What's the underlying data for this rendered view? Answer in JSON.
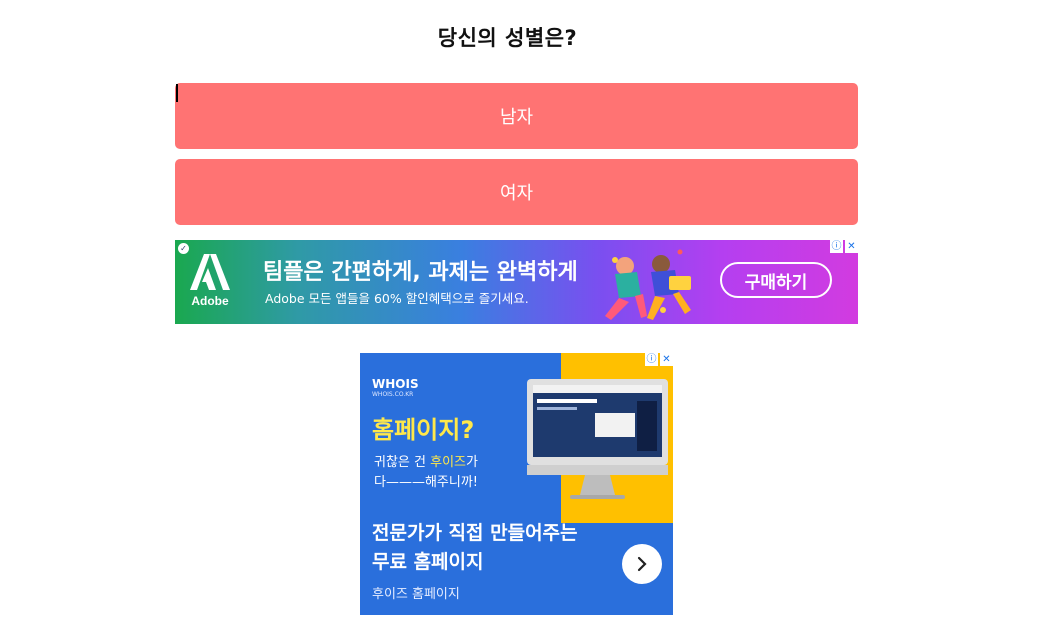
{
  "quiz": {
    "question": "당신의 성별은?",
    "answers": [
      "남자",
      "여자"
    ]
  },
  "banner_ad": {
    "brand": "Adobe",
    "headline": "팀플은 간편하게, 과제는 완벽하게",
    "subline": "Adobe 모든 앱들을 60% 할인혜택으로 즐기세요.",
    "cta": "구매하기",
    "adchoices_icons": [
      "info-icon",
      "close-icon"
    ]
  },
  "square_ad": {
    "logo": "WHOIS",
    "logo_sub": "WHOIS.CO.KR",
    "headline": "홈페이지?",
    "line1_prefix": "귀찮은 건 ",
    "line1_highlight": "후이즈",
    "line1_suffix": "가",
    "line2": "다———해주니까!",
    "main_text_line1": "전문가가 직접 만들어주는",
    "main_text_line2": "무료 홈페이지",
    "source": "후이즈 홈페이지",
    "arrow_icon": "chevron-right-icon"
  },
  "colors": {
    "answer_button": "#ff7373",
    "square_blue": "#2a6fdc",
    "square_yellow": "#ffc000",
    "headline_yellow": "#ffe84a"
  }
}
